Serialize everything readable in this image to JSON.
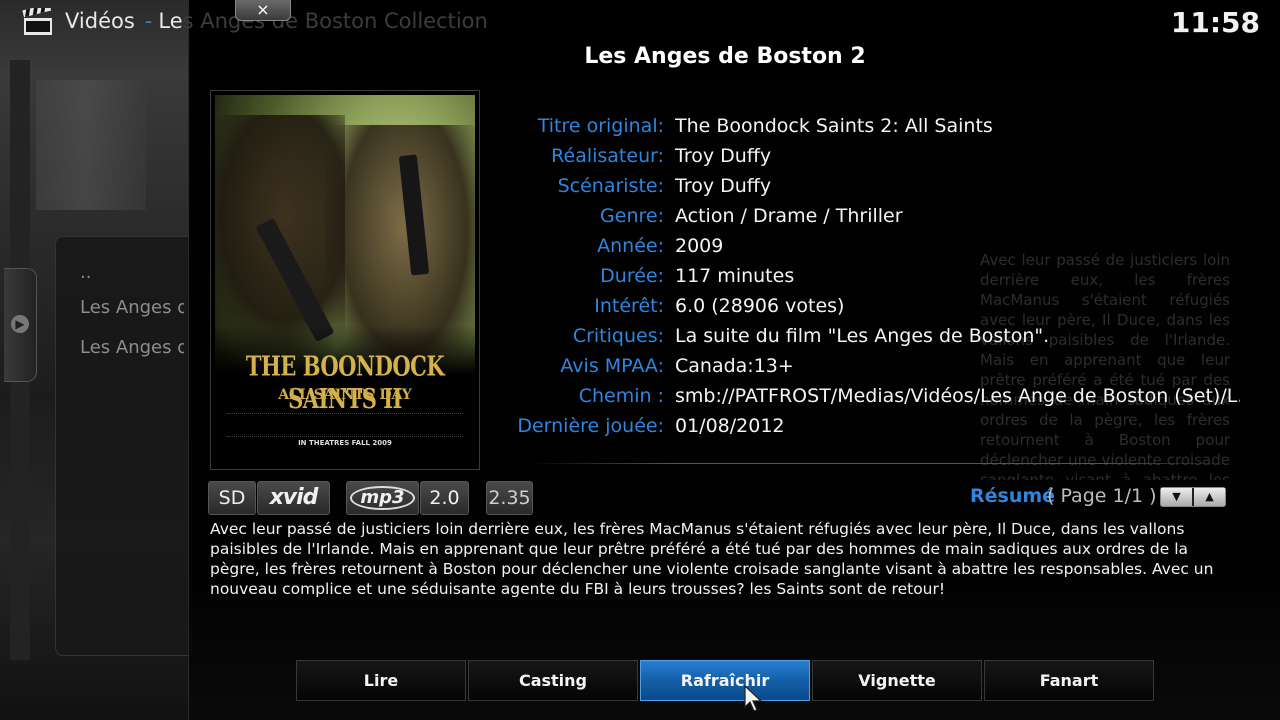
{
  "header": {
    "icon": "clapperboard-icon",
    "section": "Vidéos",
    "separator": "-",
    "subtitle_visible": "Le",
    "subtitle_faded": "s Anges de Boston Collection",
    "close_label": "×"
  },
  "clock": "11:58",
  "side_list": {
    "items": [
      "..",
      "Les Anges d",
      "Les Anges d"
    ]
  },
  "movie": {
    "title": "Les Anges de Boston 2",
    "poster": {
      "title": "THE BOONDOCK SAINTS II",
      "subtitle": "ALL SAINTS DAY",
      "tagline": "IN THEATRES FALL 2009"
    },
    "fields": [
      {
        "label": "Titre original:",
        "value": "The Boondock Saints 2: All Saints"
      },
      {
        "label": "Réalisateur:",
        "value": "Troy Duffy"
      },
      {
        "label": "Scénariste:",
        "value": "Troy Duffy"
      },
      {
        "label": "Genre:",
        "value": "Action / Drame / Thriller"
      },
      {
        "label": "Année:",
        "value": "2009"
      },
      {
        "label": "Durée:",
        "value": "117 minutes"
      },
      {
        "label": "Intérêt:",
        "value": "6.0 (28906 votes)"
      },
      {
        "label": "Critiques:",
        "value": "La suite du film \"Les Anges de Boston\"."
      },
      {
        "label": "Avis MPAA:",
        "value": "Canada:13+"
      },
      {
        "label": "Chemin :",
        "value": "smb://PATFROST/Medias/Vidéos/Les Ange de Boston (Set)/L..."
      },
      {
        "label": "Dernière jouée:",
        "value": "01/08/2012"
      }
    ],
    "flags": {
      "resolution": "SD",
      "video_codec": "xvid",
      "audio_codec": "mp3",
      "audio_channels": "2.0",
      "aspect_ratio": "2.35"
    },
    "summary_label": "Résumé",
    "page_info": "( Page 1/1 )",
    "plot": "Avec leur passé de justiciers loin derrière eux, les frères MacManus s'étaient réfugiés avec leur père, Il Duce, dans les vallons paisibles de l'Irlande. Mais en apprenant que leur prêtre préféré a été tué par des hommes de main sadiques aux ordres de la pègre, les frères retournent à Boston pour déclencher une violente croisade sanglante visant à abattre les responsables. Avec un nouveau complice et une séduisante agente du FBI à leurs trousses? les Saints sont de retour!"
  },
  "buttons": [
    {
      "label": "Lire"
    },
    {
      "label": "Casting"
    },
    {
      "label": "Rafraîchir",
      "focused": true
    },
    {
      "label": "Vignette"
    },
    {
      "label": "Fanart"
    }
  ],
  "colors": {
    "accent_blue": "#2f86de",
    "focused_button": "#135ea8",
    "poster_title_gold": "#d6b24a"
  }
}
